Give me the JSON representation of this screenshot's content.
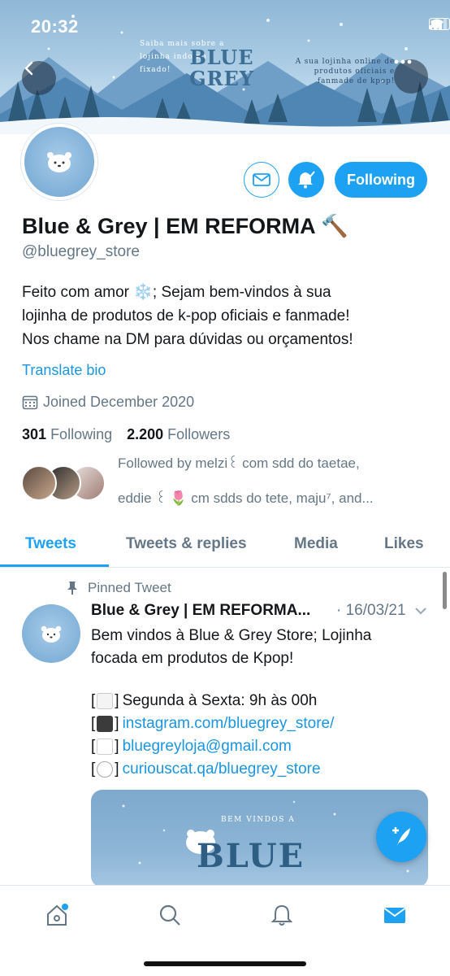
{
  "status_bar": {
    "time": "20:32"
  },
  "banner": {
    "left_text": "Saiba mais sobre a lojinha indo no fixado!",
    "logo_line1": "BLUE",
    "logo_line2": "GREY",
    "right_text": "A sua lojinha online de produtos oficiais e fanmade de kpop!"
  },
  "header_buttons": {
    "back_icon": "chevron-left-icon",
    "more_icon": "ellipsis-icon"
  },
  "profile": {
    "name": "Blue & Grey | EM REFORMA 🔨",
    "handle": "@bluegrey_store",
    "bio_lines": [
      "Feito com amor ❄️; Sejam bem-vindos à sua",
      "lojinha de produtos de k-pop oficiais e fanmade!",
      "Nos chame na DM para dúvidas ou orçamentos!"
    ],
    "translate_label": "Translate bio",
    "joined": "Joined December 2020",
    "following_count": "301",
    "following_label": "Following",
    "followers_count": "2.200",
    "followers_label": "Followers",
    "followed_by_line1": "Followed by melzi꒰ com sdd do taetae,",
    "followed_by_line2": "eddie ꒰ 🌷 cm sdds do tete, maju⁷, and..."
  },
  "actions": {
    "follow_button": "Following"
  },
  "tabs": [
    "Tweets",
    "Tweets & replies",
    "Media",
    "Likes"
  ],
  "pinned_tweet": {
    "pinned_label": "Pinned Tweet",
    "author": "Blue & Grey | EM REFORMA...",
    "date": "· 16/03/21",
    "text_line1": "Bem vindos à Blue & Grey Store; Lojinha",
    "text_line2": "focada em produtos de Kpop!",
    "schedule": "Segunda à Sexta: 9h às 00h",
    "instagram": "instagram.com/bluegrey_store/",
    "email": "bluegreyloja@gmail.com",
    "curiouscat": "curiouscat.qa/bluegrey_store",
    "media_title": "BEM VINDOS A",
    "media_logo": "BLUE"
  },
  "colors": {
    "accent": "#1da1f2",
    "secondary_text": "#657786",
    "link": "#1b95e0"
  }
}
